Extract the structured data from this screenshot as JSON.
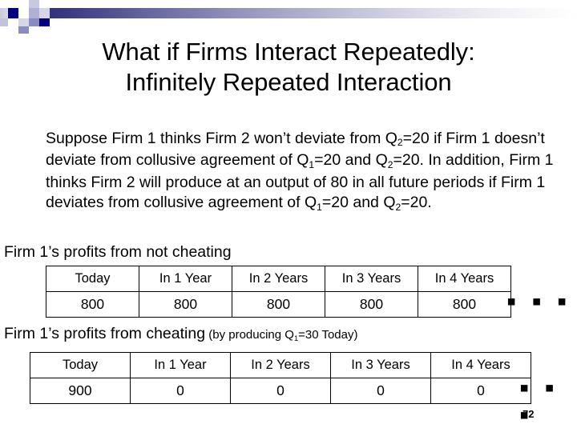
{
  "slide": {
    "title_line_1": "What if Firms Interact Repeatedly:",
    "title_line_2": "Infinitely Repeated Interaction",
    "page_number": "72"
  },
  "decoration": {
    "name": "header-gradient-band-with-squares",
    "gradient_start_color": "#2e2e77",
    "gradient_end_color": "#ffffff",
    "square_dark_color": "#000080",
    "square_mid_color": "#8a8ac4",
    "square_light_color": "#c8c8e0"
  },
  "body": {
    "paragraph_parts": [
      {
        "text": "Suppose Firm 1 thinks Firm 2 won’t deviate from Q"
      },
      {
        "sub": "2"
      },
      {
        "text": "=20 if Firm 1 doesn’t deviate from collusive agreement of Q"
      },
      {
        "sub": "1"
      },
      {
        "text": "=20 and Q"
      },
      {
        "sub": "2"
      },
      {
        "text": "=20. In addition, Firm 1 thinks Firm 2 will produce at an output of 80 in all future periods if Firm 1 deviates from collusive agreement of Q"
      },
      {
        "sub": "1"
      },
      {
        "text": "=20 and Q"
      },
      {
        "sub": "2"
      },
      {
        "text": "=20."
      }
    ],
    "paragraph_plain": "Suppose Firm 1 thinks Firm 2 won’t deviate from Q2=20 if Firm 1 doesn’t deviate from collusive agreement of Q1=20 and Q2=20. In addition, Firm 1 thinks Firm 2 will produce at an output of 80 in all future periods if Firm 1 deviates from collusive agreement of Q1=20 and Q2=20."
  },
  "sections": [
    {
      "id": "not-cheating",
      "heading": "Firm 1’s profits from not cheating",
      "heading_note": "",
      "ellipsis": "▪ ▪ ▪",
      "table": {
        "headers": [
          "Today",
          "In 1 Year",
          "In 2 Years",
          "In 3 Years",
          "In 4 Years"
        ],
        "values": [
          "800",
          "800",
          "800",
          "800",
          "800"
        ]
      }
    },
    {
      "id": "cheating",
      "heading": "Firm 1’s profits from cheating",
      "heading_note_parts": [
        {
          "text": " (by producing Q"
        },
        {
          "sub": "1"
        },
        {
          "text": "=30 Today)"
        }
      ],
      "heading_note": " (by producing Q1=30 Today)",
      "ellipsis": "▪ ▪ ▪",
      "table": {
        "headers": [
          "Today",
          "In 1 Year",
          "In 2 Years",
          "In 3 Years",
          "In 4 Years"
        ],
        "values": [
          "900",
          "0",
          "0",
          "0",
          "0"
        ]
      }
    }
  ]
}
